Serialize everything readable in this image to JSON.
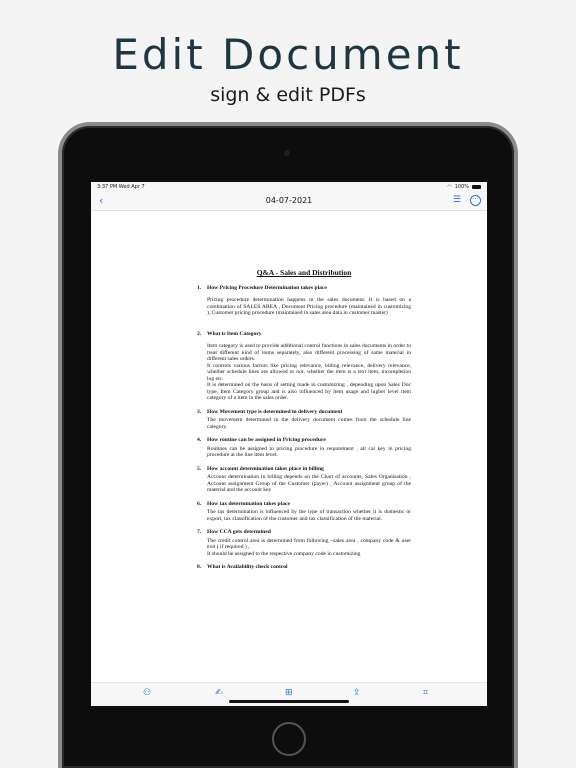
{
  "promo": {
    "headline": "Edit Document",
    "subline": "sign & edit PDFs"
  },
  "statusbar": {
    "time": "3:37 PM  Wed Apr 7",
    "battery": "100%"
  },
  "navbar": {
    "title": "04-07-2021"
  },
  "document": {
    "title": "Q&A - Sales and Distribution",
    "sections": [
      {
        "num": "1.",
        "question": "How Pricing Procedure Determination takes place",
        "answer": "Pricing procedure determination happens in the sales document. It is based on a combination of SALES AREA , Document Pricing procedure (maintained in customizing ), Customer pricing procedure (maintained in sales area data in customer master)"
      },
      {
        "num": "2.",
        "question": "What is Item Category",
        "answer_lines": [
          "Item category is used to provide additional control functions in sales documents in order to treat different kind of items separately, also different processing of same material in different sales orders.",
          "It controls various factors like pricing relevance, billing relevance, delivery relevance, whether schedule lines are allowed or not, whether the item is a text item, incompletion log etc.",
          "It is determined on the basis of setting made in customizing , depending upon Sales Doc type, Item Category group and is also influenced by item usage and higher level item category of a item in the sales order."
        ]
      },
      {
        "num": "3.",
        "question": "How Movement type is determined in delivery document",
        "answer": "The movement determined in the delivery document comes from the schedule line category."
      },
      {
        "num": "4.",
        "question": "How routine can be assigned in Pricing procedure",
        "answer": "Routines can be assigned to pricing procedure in requirement , alt cal key in pricing procedure at the line item level."
      },
      {
        "num": "5.",
        "question": "How account determination takes place in billing",
        "answer": "Account determination in billing depends on the Chart of accounts, Sales Organisation , Account assignment Group of the Customer (payer) , Account assignment group of the material and the account key"
      },
      {
        "num": "6.",
        "question": "How tax determination takes place",
        "answer": "The tax determination is influenced by the type of transaction whether it is domestic or export, tax classification of the customer and tax classification of the material."
      },
      {
        "num": "7.",
        "question": "How CCA gets determined",
        "answer_lines": [
          "The credit control area is determined from following –sales area , company code & user exit ( if required ) ,",
          "It should be assigned to the respective company code in customizing"
        ]
      },
      {
        "num": "8.",
        "question": "What is Availability check control"
      }
    ]
  },
  "toolbar": {
    "icons": [
      "shapes-icon",
      "signature-icon",
      "add-page-icon",
      "share-icon",
      "scan-icon"
    ]
  },
  "colors": {
    "accent": "#2f6fd6",
    "headline": "#1f3641",
    "background": "#f4f4f4"
  }
}
